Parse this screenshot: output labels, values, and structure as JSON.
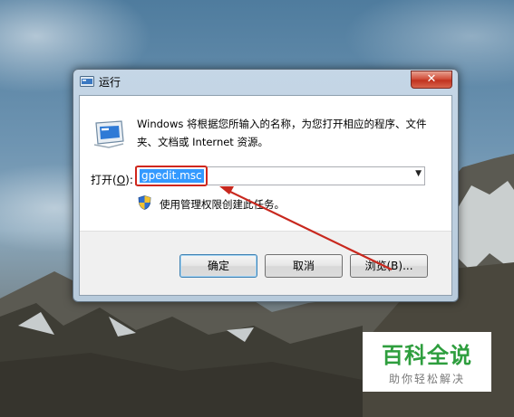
{
  "window": {
    "title": "运行",
    "close_glyph": "✕"
  },
  "dialog": {
    "description": "Windows 将根据您所输入的名称，为您打开相应的程序、文件夹、文档或 Internet 资源。",
    "open_label_prefix": "打开(",
    "open_label_key": "O",
    "open_label_suffix": "):",
    "command_value": "gpedit.msc",
    "dropdown_glyph": "▼",
    "admin_text": "使用管理权限创建此任务。"
  },
  "buttons": {
    "ok": "确定",
    "cancel": "取消",
    "browse": "浏览(B)..."
  },
  "watermark": {
    "title": "百科全说",
    "subtitle": "助你轻松解决"
  },
  "colors": {
    "highlight": "#d0261c",
    "selection": "#3399ff",
    "watermark_green": "#2e9e3e"
  },
  "icons": [
    "run-program-icon",
    "uac-shield-icon",
    "close-icon",
    "dropdown-arrow-icon"
  ]
}
